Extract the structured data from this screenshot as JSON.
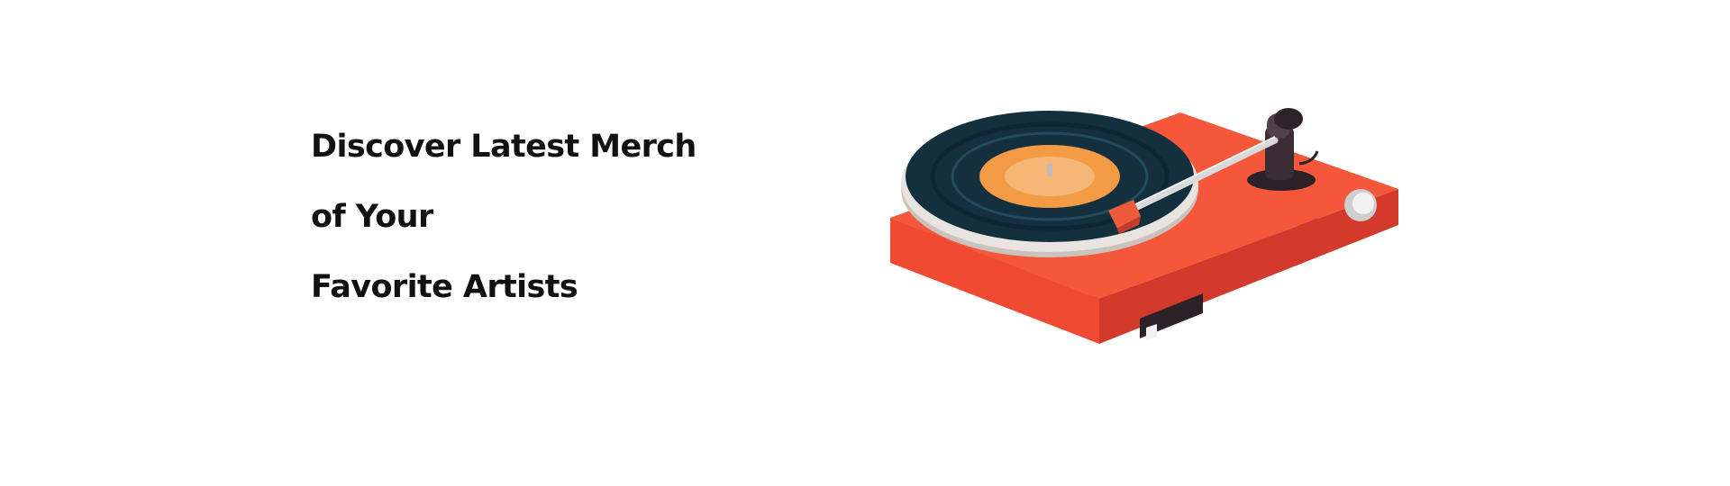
{
  "hero": {
    "headline_lines": [
      "Discover Latest Merch",
      "of Your",
      "Favorite Artists"
    ]
  },
  "illustration": {
    "icon": "record-player-icon",
    "colors": {
      "base": "#f4573a",
      "base_side": "#d83a2a",
      "shadow": "#d9a79c",
      "record": "#16303f",
      "label": "#f39a44",
      "label_center": "#f6b676",
      "tonearm": "#d9d9d9",
      "arm_pivot": "#2e2328",
      "cartridge": "#ef5a3c",
      "knob": "#e6e6e6"
    }
  }
}
